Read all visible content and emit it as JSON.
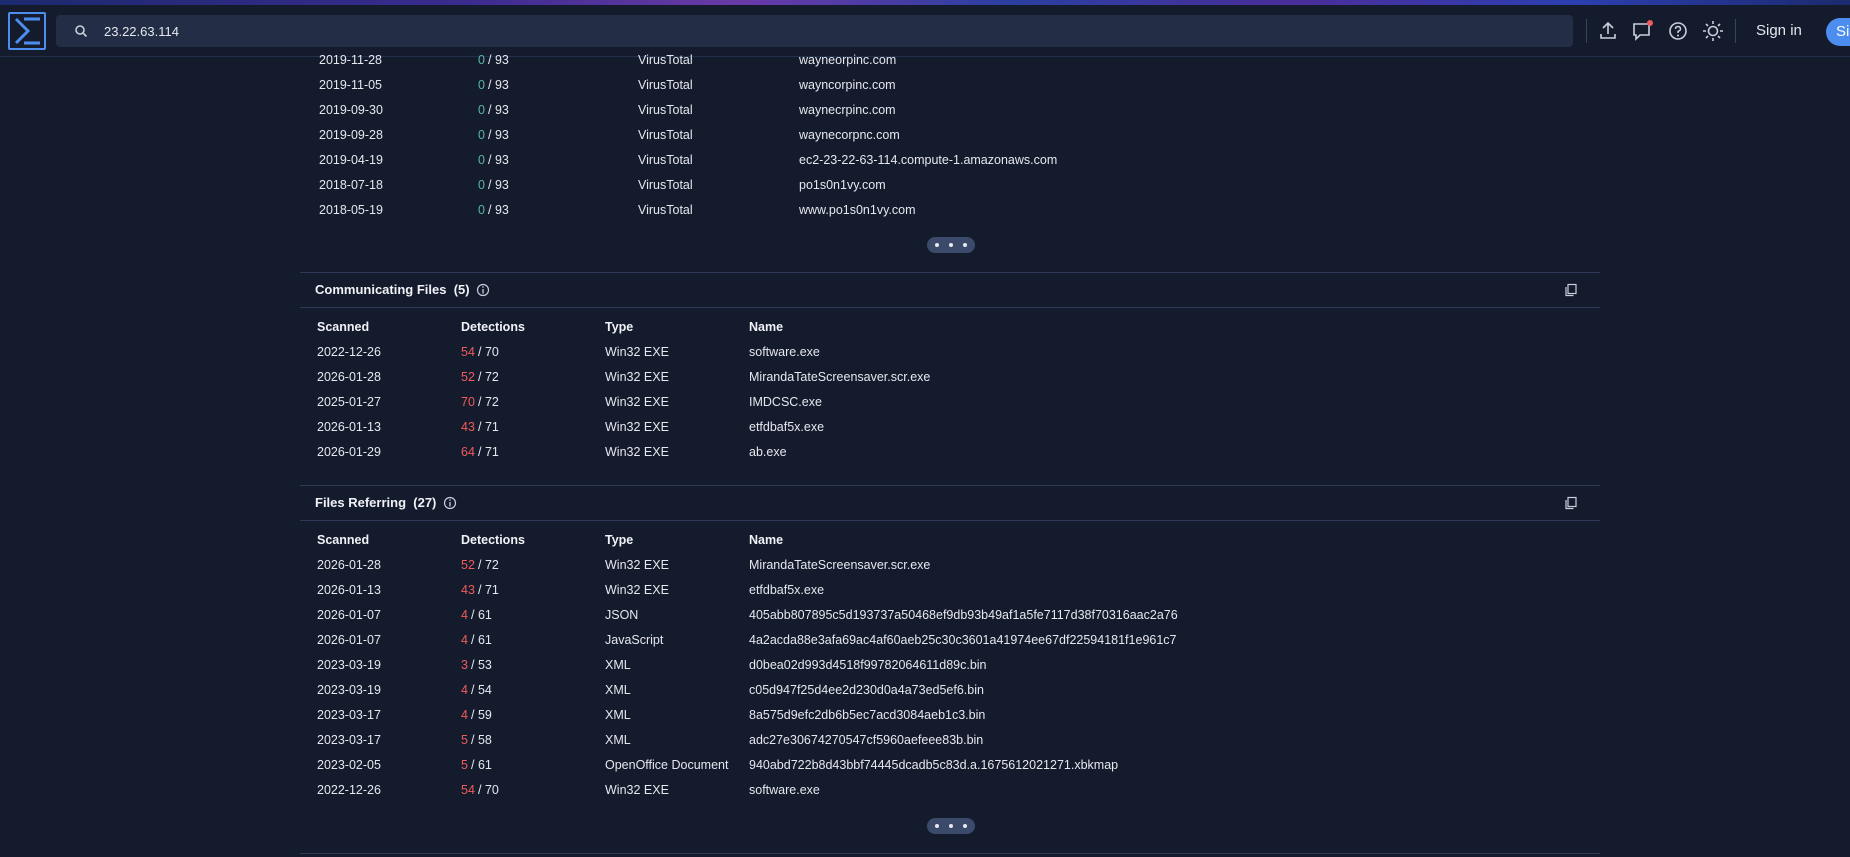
{
  "topbar": {
    "search_value": "23.22.63.114",
    "signin_label": "Sign in",
    "signup_label": "Sign up",
    "icons": [
      "upload-icon",
      "chat-icon",
      "help-icon",
      "theme-icon"
    ],
    "accent": "#4c8ef0",
    "notification_color": "#f05b5b"
  },
  "resolutions": {
    "rows": [
      {
        "date": "2019-11-28",
        "det": "0",
        "total": "/ 93",
        "source": "VirusTotal",
        "host": "wayneorpinc.com"
      },
      {
        "date": "2019-11-05",
        "det": "0",
        "total": "/ 93",
        "source": "VirusTotal",
        "host": "wayncorpinc.com"
      },
      {
        "date": "2019-09-30",
        "det": "0",
        "total": "/ 93",
        "source": "VirusTotal",
        "host": "waynecrpinc.com"
      },
      {
        "date": "2019-09-28",
        "det": "0",
        "total": "/ 93",
        "source": "VirusTotal",
        "host": "waynecorpnc.com"
      },
      {
        "date": "2019-04-19",
        "det": "0",
        "total": "/ 93",
        "source": "VirusTotal",
        "host": "ec2-23-22-63-114.compute-1.amazonaws.com"
      },
      {
        "date": "2018-07-18",
        "det": "0",
        "total": "/ 93",
        "source": "VirusTotal",
        "host": "po1s0n1vy.com"
      },
      {
        "date": "2018-05-19",
        "det": "0",
        "total": "/ 93",
        "source": "VirusTotal",
        "host": "www.po1s0n1vy.com"
      }
    ]
  },
  "communicating": {
    "title": "Communicating Files",
    "count": "(5)",
    "headers": {
      "scanned": "Scanned",
      "detections": "Detections",
      "type": "Type",
      "name": "Name"
    },
    "rows": [
      {
        "date": "2022-12-26",
        "det": "54",
        "total": "/ 70",
        "type": "Win32 EXE",
        "name": "software.exe"
      },
      {
        "date": "2026-01-28",
        "det": "52",
        "total": "/ 72",
        "type": "Win32 EXE",
        "name": "MirandaTateScreensaver.scr.exe"
      },
      {
        "date": "2025-01-27",
        "det": "70",
        "total": "/ 72",
        "type": "Win32 EXE",
        "name": "IMDCSC.exe"
      },
      {
        "date": "2026-01-13",
        "det": "43",
        "total": "/ 71",
        "type": "Win32 EXE",
        "name": "etfdbaf5x.exe"
      },
      {
        "date": "2026-01-29",
        "det": "64",
        "total": "/ 71",
        "type": "Win32 EXE",
        "name": "ab.exe"
      }
    ]
  },
  "referring": {
    "title": "Files Referring",
    "count": "(27)",
    "headers": {
      "scanned": "Scanned",
      "detections": "Detections",
      "type": "Type",
      "name": "Name"
    },
    "rows": [
      {
        "date": "2026-01-28",
        "det": "52",
        "total": "/ 72",
        "type": "Win32 EXE",
        "name": "MirandaTateScreensaver.scr.exe"
      },
      {
        "date": "2026-01-13",
        "det": "43",
        "total": "/ 71",
        "type": "Win32 EXE",
        "name": "etfdbaf5x.exe"
      },
      {
        "date": "2026-01-07",
        "det": "4",
        "total": "/ 61",
        "type": "JSON",
        "name": "405abb807895c5d193737a50468ef9db93b49af1a5fe7117d38f70316aac2a76"
      },
      {
        "date": "2026-01-07",
        "det": "4",
        "total": "/ 61",
        "type": "JavaScript",
        "name": "4a2acda88e3afa69ac4af60aeb25c30c3601a41974ee67df22594181f1e961c7"
      },
      {
        "date": "2023-03-19",
        "det": "3",
        "total": "/ 53",
        "type": "XML",
        "name": "d0bea02d993d4518f99782064611d89c.bin"
      },
      {
        "date": "2023-03-19",
        "det": "4",
        "total": "/ 54",
        "type": "XML",
        "name": "c05d947f25d4ee2d230d0a4a73ed5ef6.bin"
      },
      {
        "date": "2023-03-17",
        "det": "4",
        "total": "/ 59",
        "type": "XML",
        "name": "8a575d9efc2db6b5ec7acd3084aeb1c3.bin"
      },
      {
        "date": "2023-03-17",
        "det": "5",
        "total": "/ 58",
        "type": "XML",
        "name": "adc27e30674270547cf5960aefeee83b.bin"
      },
      {
        "date": "2023-02-05",
        "det": "5",
        "total": "/ 61",
        "type": "OpenOffice Document",
        "name": "940abd722b8d43bbf74445dcadb5c83d.a.1675612021271.xbkmap"
      },
      {
        "date": "2022-12-26",
        "det": "54",
        "total": "/ 70",
        "type": "Win32 EXE",
        "name": "software.exe"
      }
    ]
  }
}
